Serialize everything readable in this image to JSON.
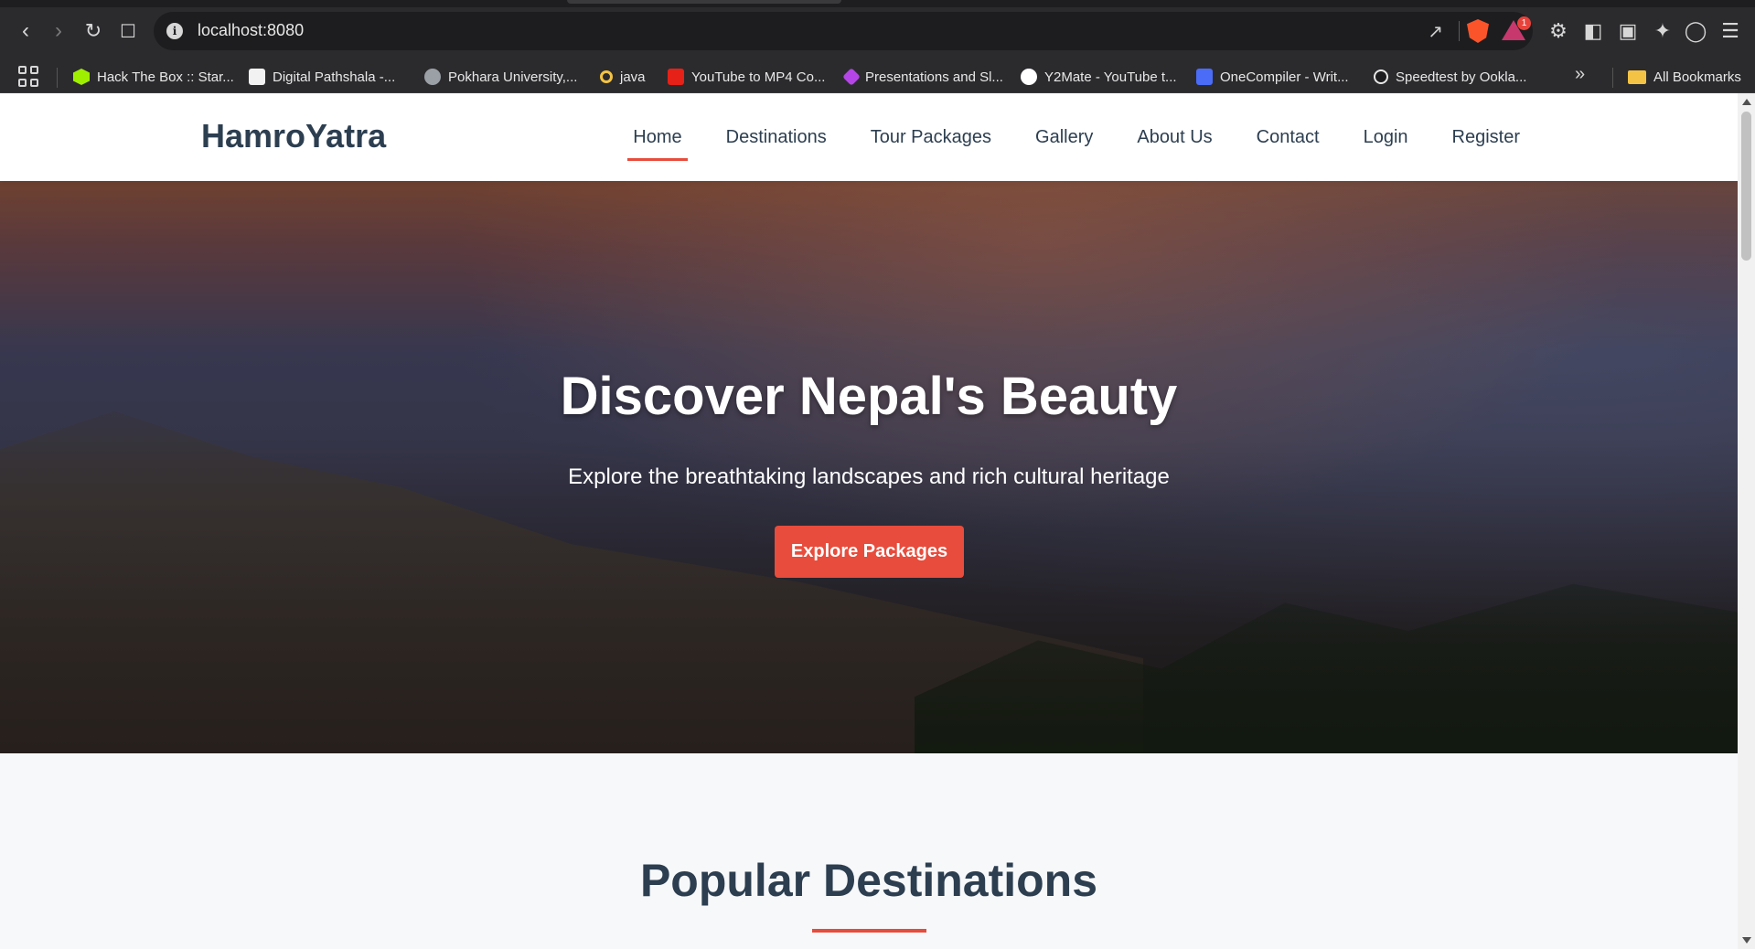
{
  "browser": {
    "url": "localhost:8080",
    "notification_count": "1",
    "bookmarks": [
      {
        "label": "Hack The Box :: Star...",
        "color": "#9fef00"
      },
      {
        "label": "Digital Pathshala -...",
        "color": "#f2f2f2"
      },
      {
        "label": "Pokhara University,...",
        "color": "#9aa0a6"
      },
      {
        "label": "java",
        "color": "#f3c345"
      },
      {
        "label": "YouTube to MP4 Co...",
        "color": "#e62117"
      },
      {
        "label": "Presentations and Sl...",
        "color": "#b545e6"
      },
      {
        "label": "Y2Mate - YouTube t...",
        "color": "#ffffff"
      },
      {
        "label": "OneCompiler - Writ...",
        "color": "#4a6cf7"
      },
      {
        "label": "Speedtest by Ookla...",
        "color": "#1d1d1f"
      }
    ],
    "all_bookmarks": "All Bookmarks"
  },
  "site": {
    "logo": "HamroYatra",
    "nav": {
      "home": "Home",
      "destinations": "Destinations",
      "tour_packages": "Tour Packages",
      "gallery": "Gallery",
      "about": "About Us",
      "contact": "Contact",
      "login": "Login",
      "register": "Register"
    },
    "accent_color": "#e74c3c",
    "text_color": "#2c3e50"
  },
  "hero": {
    "title": "Discover Nepal's Beauty",
    "subtitle": "Explore the breathtaking landscapes and rich cultural heritage",
    "cta": "Explore Packages"
  },
  "popular": {
    "title": "Popular Destinations"
  }
}
